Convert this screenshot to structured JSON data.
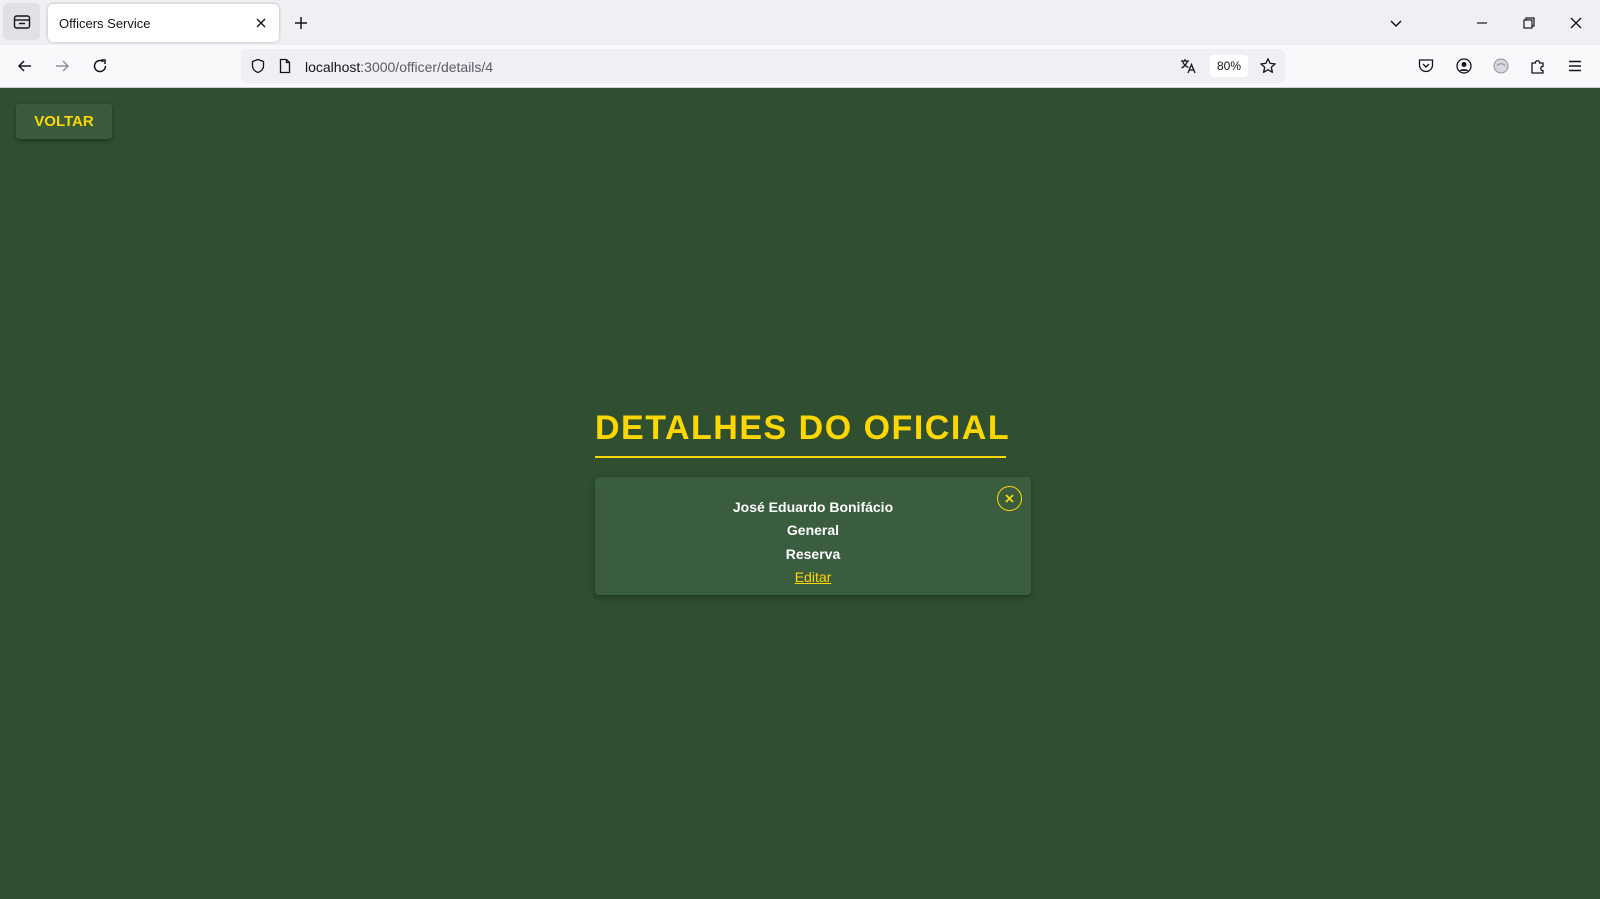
{
  "browser": {
    "tab_title": "Officers Service",
    "url_host": "localhost",
    "url_path": ":3000/officer/details/4",
    "zoom": "80%"
  },
  "page": {
    "back_label": "VOLTAR",
    "title": "DETALHES DO OFICIAL",
    "officer": {
      "name": "José Eduardo Bonifácio",
      "rank": "General",
      "status": "Reserva",
      "edit_label": "Editar"
    }
  },
  "colors": {
    "background": "#2f4f30",
    "accent": "#ffd700",
    "card": "#3a5c3f"
  },
  "icons": {
    "tab_list": "tab-list-icon",
    "tab_close": "close-icon",
    "new_tab": "plus-icon",
    "back": "arrow-left-icon",
    "forward": "arrow-right-icon",
    "reload": "reload-icon",
    "shield": "shield-icon",
    "page": "page-icon",
    "translate": "translate-icon",
    "bookmark": "star-icon",
    "pocket": "pocket-icon",
    "account": "account-icon",
    "extension": "extension-icon",
    "puzzle": "puzzle-icon",
    "menu": "hamburger-icon",
    "card_close": "close-circle-icon"
  }
}
